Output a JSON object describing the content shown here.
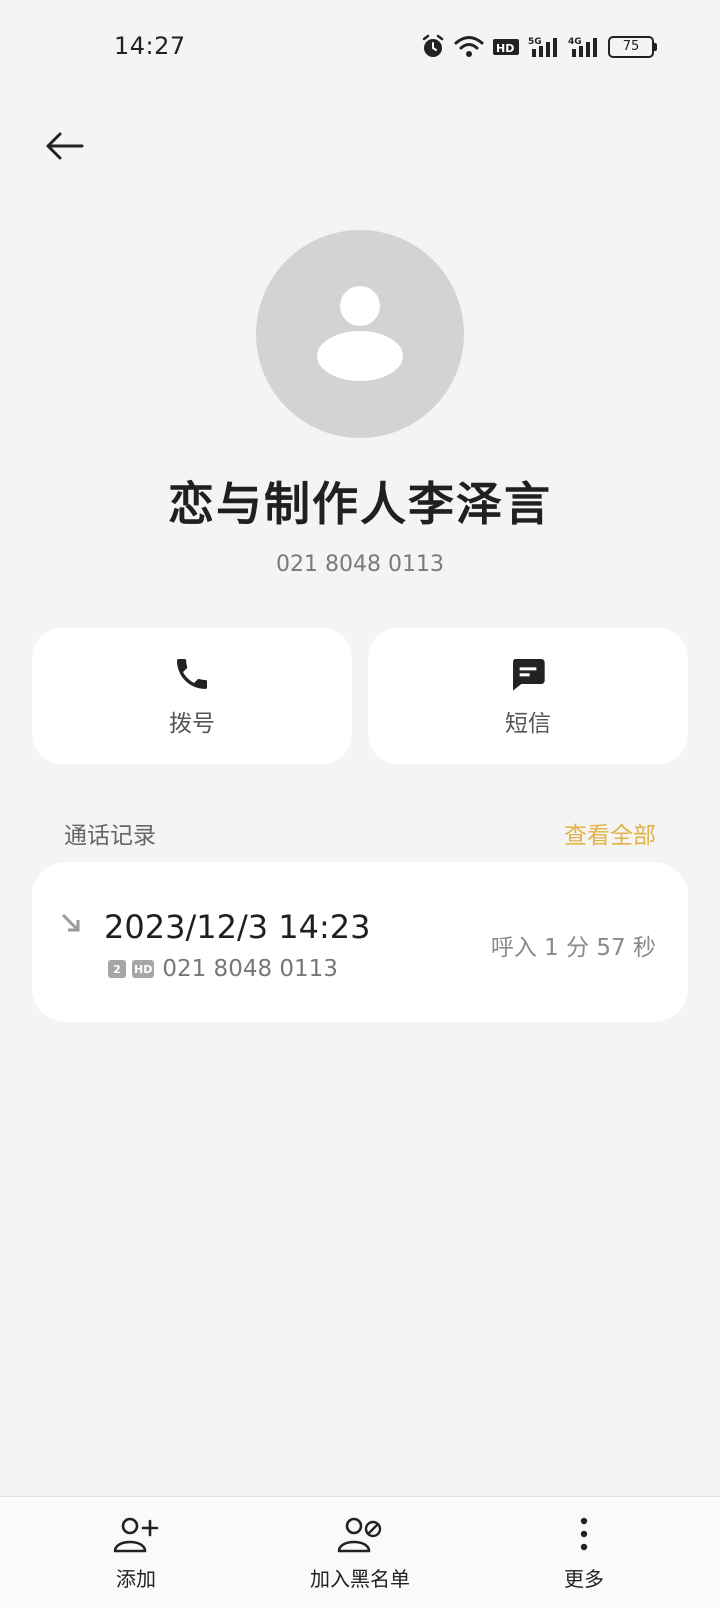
{
  "status_bar": {
    "time": "14:27",
    "battery": "75",
    "icons": [
      "alarm-icon",
      "wifi-icon",
      "hd-icon",
      "signal-5g-icon",
      "signal-4g-icon",
      "battery-icon"
    ]
  },
  "contact": {
    "name": "恋与制作人李泽言",
    "number": "021 8048 0113"
  },
  "actions": {
    "dial_label": "拨号",
    "sms_label": "短信"
  },
  "call_log": {
    "title": "通话记录",
    "view_all": "查看全部",
    "entries": [
      {
        "datetime": "2023/12/3 14:23",
        "sim": "2",
        "hd": "HD",
        "number": "021 8048 0113",
        "meta": "呼入  1 分 57 秒"
      }
    ]
  },
  "bottom_bar": {
    "add_label": "添加",
    "block_label": "加入黑名单",
    "more_label": "更多"
  },
  "colors": {
    "accent": "#e2b247",
    "background": "#f4f4f4",
    "card": "#ffffff",
    "avatar_bg": "#d3d3d3"
  }
}
